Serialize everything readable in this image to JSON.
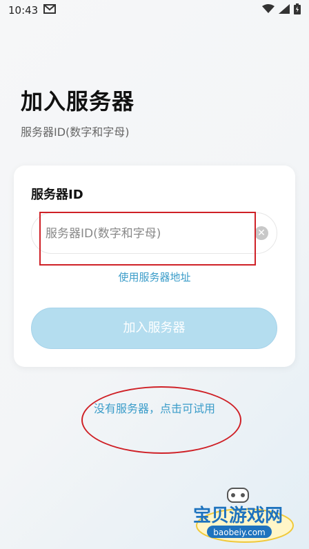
{
  "status_bar": {
    "time": "10:43",
    "icons": [
      "mail-icon",
      "wifi-icon",
      "signal-icon",
      "battery-icon"
    ]
  },
  "page": {
    "title": "加入服务器",
    "subtitle": "服务器ID(数字和字母)"
  },
  "card": {
    "label": "服务器ID",
    "input_placeholder": "服务器ID(数字和字母)",
    "input_value": "",
    "use_address_link": "使用服务器地址",
    "join_button": "加入服务器"
  },
  "footer": {
    "try_link": "没有服务器，点击可试用"
  },
  "watermark": {
    "text": "宝贝游戏网",
    "url": "baobeiy.com"
  },
  "colors": {
    "accent": "#3a9cc9",
    "button_disabled": "#b4ddef",
    "annotation_red": "#cf2026"
  }
}
